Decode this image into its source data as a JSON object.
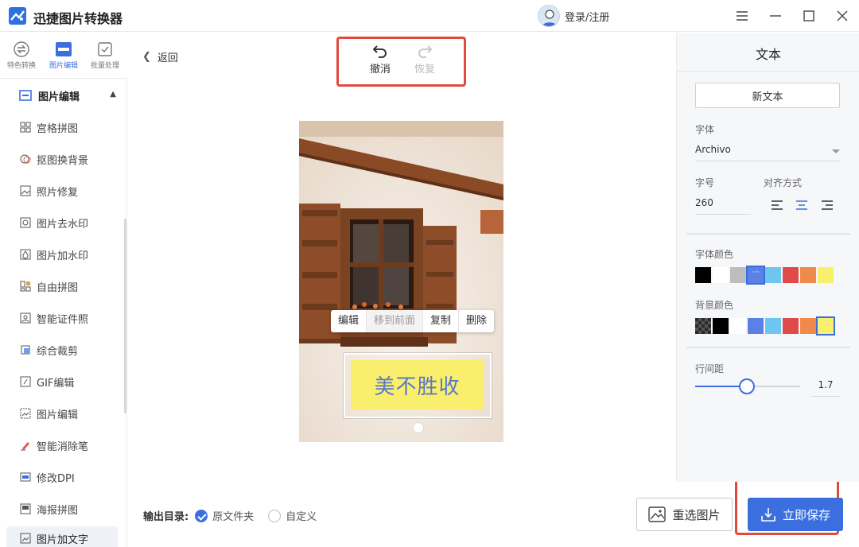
{
  "app": {
    "title": "迅捷图片转换器",
    "login_text": "登录/注册"
  },
  "window_controls": [
    "menu-icon",
    "minimize-icon",
    "maximize-icon",
    "close-icon"
  ],
  "left_tabs": [
    {
      "label": "特色转换",
      "icon": "convert-icon",
      "active": false
    },
    {
      "label": "图片编辑",
      "icon": "image-edit-icon",
      "active": true
    },
    {
      "label": "批量处理",
      "icon": "batch-icon",
      "active": false
    }
  ],
  "sidebar": {
    "section_title": "图片编辑",
    "items": [
      {
        "label": "宫格拼图",
        "icon": "grid-icon"
      },
      {
        "label": "抠图换背景",
        "icon": "cutout-icon"
      },
      {
        "label": "照片修复",
        "icon": "photo-repair-icon"
      },
      {
        "label": "图片去水印",
        "icon": "remove-watermark-icon"
      },
      {
        "label": "图片加水印",
        "icon": "add-watermark-icon"
      },
      {
        "label": "自由拼图",
        "icon": "collage-icon"
      },
      {
        "label": "智能证件照",
        "icon": "id-photo-icon"
      },
      {
        "label": "综合裁剪",
        "icon": "crop-icon"
      },
      {
        "label": "GIF编辑",
        "icon": "gif-icon"
      },
      {
        "label": "图片编辑",
        "icon": "edit-image-icon"
      },
      {
        "label": "智能消除笔",
        "icon": "eraser-pen-icon"
      },
      {
        "label": "修改DPI",
        "icon": "dpi-icon"
      },
      {
        "label": "海报拼图",
        "icon": "poster-icon"
      },
      {
        "label": "图片加文字",
        "icon": "add-text-icon",
        "active": true
      }
    ]
  },
  "main": {
    "back_label": "返回",
    "undo_label": "撤消",
    "redo_label": "恢复",
    "context_menu": [
      "编辑",
      "移到前面",
      "复制",
      "删除"
    ],
    "overlay_text": "美不胜收",
    "output_label": "输出目录:",
    "output_options": [
      {
        "label": "原文件夹",
        "selected": true
      },
      {
        "label": "自定义",
        "selected": false
      }
    ],
    "reselect_label": "重选图片",
    "save_label": "立即保存"
  },
  "panel": {
    "title": "文本",
    "new_text_label": "新文本",
    "font_label": "字体",
    "font_value": "Archivo",
    "size_label": "字号",
    "size_value": "260",
    "align_label": "对齐方式",
    "align_options": [
      "left",
      "center",
      "right"
    ],
    "align_selected": "center",
    "font_color_label": "字体颜色",
    "font_colors": [
      "#000000",
      "#ffffff",
      "#bdbdbd",
      "#5b80e6",
      "#6cc6f0",
      "#e04a4a",
      "#ef8a4a",
      "#f9ef6c"
    ],
    "font_color_selected": 3,
    "bg_color_label": "背景颜色",
    "bg_colors": [
      "transparent",
      "#000000",
      "#ffffff",
      "#5b80e6",
      "#6cc6f0",
      "#e04a4a",
      "#ef8a4a",
      "#f9ef6c"
    ],
    "bg_color_selected": 7,
    "line_spacing_label": "行间距",
    "line_spacing_value": "1.7",
    "line_spacing_fraction": 0.49
  },
  "colors": {
    "accent": "#3b6fe0",
    "highlight": "#e04a3a",
    "text_bg": "#f9ef6c",
    "text_color": "#5a78c9"
  }
}
